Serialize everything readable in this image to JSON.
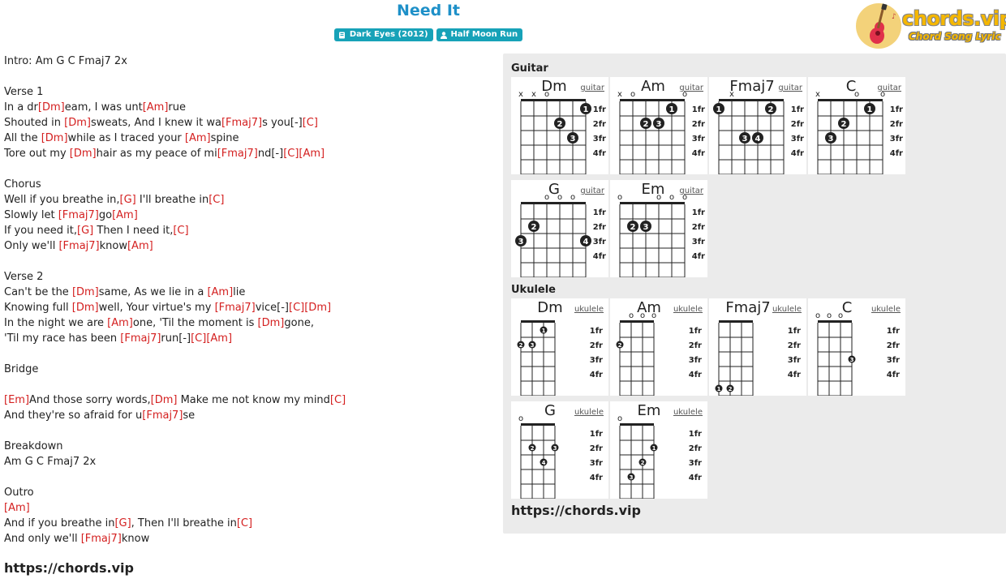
{
  "song": {
    "title": "Need It",
    "album_badge": "Dark Eyes (2012)",
    "artist_badge": "Half Moon Run"
  },
  "logo": {
    "main": "chords.vip",
    "sub": "Chord Song Lyric"
  },
  "lyrics": [
    [
      {
        "t": "Intro: Am G C Fmaj7 2x"
      }
    ],
    [],
    [
      {
        "t": "Verse 1"
      }
    ],
    [
      {
        "t": "In a dr"
      },
      {
        "c": "[Dm]"
      },
      {
        "t": "eam, I was unt"
      },
      {
        "c": "[Am]"
      },
      {
        "t": "rue"
      }
    ],
    [
      {
        "t": "Shouted in "
      },
      {
        "c": "[Dm]"
      },
      {
        "t": "sweats, And I knew it wa"
      },
      {
        "c": "[Fmaj7]"
      },
      {
        "t": "s you[-]"
      },
      {
        "c": "[C]"
      }
    ],
    [
      {
        "t": "All the "
      },
      {
        "c": "[Dm]"
      },
      {
        "t": "while as I traced your "
      },
      {
        "c": "[Am]"
      },
      {
        "t": "spine"
      }
    ],
    [
      {
        "t": "Tore out my "
      },
      {
        "c": "[Dm]"
      },
      {
        "t": "hair as my peace of mi"
      },
      {
        "c": "[Fmaj7]"
      },
      {
        "t": "nd[-]"
      },
      {
        "c": "[C]"
      },
      {
        "c": "[Am]"
      }
    ],
    [],
    [
      {
        "t": "Chorus"
      }
    ],
    [
      {
        "t": "Well if you breathe in,"
      },
      {
        "c": "[G]"
      },
      {
        "t": " I'll breathe in"
      },
      {
        "c": "[C]"
      }
    ],
    [
      {
        "t": "Slowly let "
      },
      {
        "c": "[Fmaj7]"
      },
      {
        "t": "go"
      },
      {
        "c": "[Am]"
      }
    ],
    [
      {
        "t": "If you need it,"
      },
      {
        "c": "[G]"
      },
      {
        "t": " Then I need it,"
      },
      {
        "c": "[C]"
      }
    ],
    [
      {
        "t": "Only we'll "
      },
      {
        "c": "[Fmaj7]"
      },
      {
        "t": "know"
      },
      {
        "c": "[Am]"
      }
    ],
    [],
    [
      {
        "t": "Verse 2"
      }
    ],
    [
      {
        "t": "Can't be the "
      },
      {
        "c": "[Dm]"
      },
      {
        "t": "same, As we lie in a "
      },
      {
        "c": "[Am]"
      },
      {
        "t": "lie"
      }
    ],
    [
      {
        "t": "Knowing full "
      },
      {
        "c": "[Dm]"
      },
      {
        "t": "well, Your virtue's my "
      },
      {
        "c": "[Fmaj7]"
      },
      {
        "t": "vice[-]"
      },
      {
        "c": "[C]"
      },
      {
        "c": "[Dm]"
      }
    ],
    [
      {
        "t": "In the night we are "
      },
      {
        "c": "[Am]"
      },
      {
        "t": "one, 'Til the moment is "
      },
      {
        "c": "[Dm]"
      },
      {
        "t": "gone,"
      }
    ],
    [
      {
        "t": "'Til my race has been "
      },
      {
        "c": "[Fmaj7]"
      },
      {
        "t": "run[-]"
      },
      {
        "c": "[C]"
      },
      {
        "c": "[Am]"
      }
    ],
    [],
    [
      {
        "t": "Bridge"
      }
    ],
    [],
    [
      {
        "c": "[Em]"
      },
      {
        "t": "And those sorry words,"
      },
      {
        "c": "[Dm]"
      },
      {
        "t": " Make me not know my mind"
      },
      {
        "c": "[C]"
      }
    ],
    [
      {
        "t": "And they're so afraid for u"
      },
      {
        "c": "[Fmaj7]"
      },
      {
        "t": "se"
      }
    ],
    [],
    [
      {
        "t": "Breakdown"
      }
    ],
    [
      {
        "t": "Am G C Fmaj7 2x"
      }
    ],
    [],
    [
      {
        "t": "Outro"
      }
    ],
    [
      {
        "c": "[Am]"
      }
    ],
    [
      {
        "t": "And if you breathe in"
      },
      {
        "c": "[G]"
      },
      {
        "t": ", Then I'll breathe in"
      },
      {
        "c": "[C]"
      }
    ],
    [
      {
        "t": "And only we'll "
      },
      {
        "c": "[Fmaj7]"
      },
      {
        "t": "know"
      }
    ]
  ],
  "footer_url": "https://chords.vip",
  "panel": {
    "guitar_label": "Guitar",
    "ukulele_label": "Ukulele",
    "url": "https://chords.vip",
    "fret_labels": [
      "1fr",
      "2fr",
      "3fr",
      "4fr"
    ],
    "guitar_chords": [
      {
        "name": "Dm",
        "link": "guitar",
        "markers": [
          "x",
          "x",
          "o",
          "",
          "",
          " "
        ],
        "dots": [
          [
            3,
            2,
            2
          ],
          [
            4,
            3,
            3
          ],
          [
            5,
            1,
            1
          ]
        ]
      },
      {
        "name": "Am",
        "link": "guitar",
        "markers": [
          "x",
          "o",
          "",
          "",
          "",
          "o"
        ],
        "dots": [
          [
            2,
            2,
            2
          ],
          [
            3,
            2,
            3
          ],
          [
            4,
            1,
            1
          ]
        ]
      },
      {
        "name": "Fmaj7",
        "link": "guitar",
        "markers": [
          "",
          "x",
          "",
          "",
          "",
          ""
        ],
        "dots": [
          [
            0,
            1,
            1
          ],
          [
            2,
            3,
            3
          ],
          [
            3,
            3,
            4
          ],
          [
            4,
            1,
            2
          ]
        ]
      },
      {
        "name": "C",
        "link": "guitar",
        "markers": [
          "x",
          "",
          "",
          "o",
          "",
          "o"
        ],
        "dots": [
          [
            1,
            3,
            3
          ],
          [
            2,
            2,
            2
          ],
          [
            4,
            1,
            1
          ]
        ]
      },
      {
        "name": "G",
        "link": "guitar",
        "markers": [
          "",
          "",
          "o",
          "o",
          "o",
          ""
        ],
        "dots": [
          [
            0,
            3,
            3
          ],
          [
            1,
            2,
            2
          ],
          [
            5,
            3,
            4
          ]
        ]
      },
      {
        "name": "Em",
        "link": "guitar",
        "markers": [
          "o",
          "",
          "",
          "o",
          "o",
          "o"
        ],
        "dots": [
          [
            1,
            2,
            2
          ],
          [
            2,
            2,
            3
          ]
        ]
      }
    ],
    "ukulele_chords": [
      {
        "name": "Dm",
        "link": "ukulele",
        "markers": [
          "",
          "",
          "",
          ""
        ],
        "dots": [
          [
            0,
            2,
            2
          ],
          [
            1,
            2,
            3
          ],
          [
            2,
            1,
            1
          ]
        ]
      },
      {
        "name": "Am",
        "link": "ukulele",
        "markers": [
          "",
          "o",
          "o",
          "o"
        ],
        "dots": [
          [
            0,
            2,
            2
          ]
        ]
      },
      {
        "name": "Fmaj7",
        "link": "ukulele",
        "markers": [
          "",
          "",
          "",
          ""
        ],
        "dots": [
          [
            0,
            5,
            1
          ],
          [
            1,
            5,
            2
          ]
        ]
      },
      {
        "name": "C",
        "link": "ukulele",
        "markers": [
          "o",
          "o",
          "o",
          ""
        ],
        "dots": [
          [
            3,
            3,
            3
          ]
        ]
      },
      {
        "name": "G",
        "link": "ukulele",
        "markers": [
          "o",
          "",
          "",
          ""
        ],
        "dots": [
          [
            1,
            2,
            2
          ],
          [
            2,
            3,
            4
          ],
          [
            3,
            2,
            3
          ]
        ]
      },
      {
        "name": "Em",
        "link": "ukulele",
        "markers": [
          "o",
          "",
          "",
          ""
        ],
        "dots": [
          [
            1,
            4,
            3
          ],
          [
            2,
            3,
            2
          ],
          [
            3,
            2,
            1
          ]
        ]
      }
    ]
  }
}
